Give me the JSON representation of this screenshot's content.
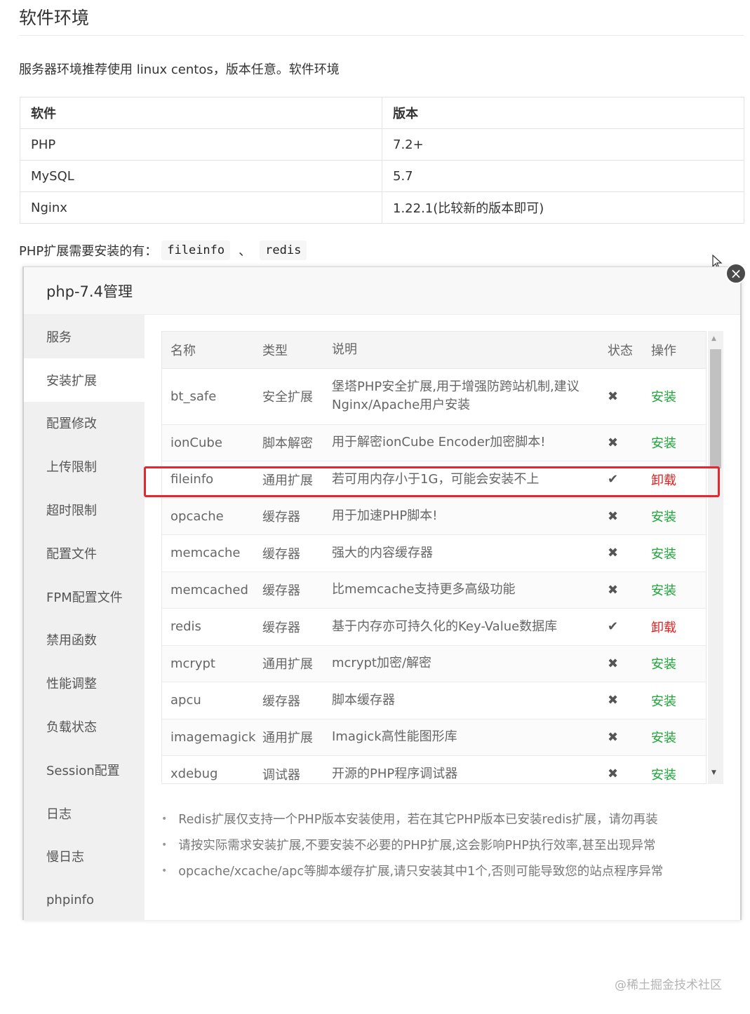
{
  "doc": {
    "heading": "软件环境",
    "paragraph": "服务器环境推荐使用 linux centos，版本任意。软件环境",
    "table": {
      "headers": [
        "软件",
        "版本"
      ],
      "rows": [
        [
          "PHP",
          "7.2+"
        ],
        [
          "MySQL",
          "5.7"
        ],
        [
          "Nginx",
          "1.22.1(比较新的版本即可)"
        ]
      ]
    },
    "ext_prefix": "PHP扩展需要安装的有：",
    "ext_1": "fileinfo",
    "ext_sep": "、",
    "ext_2": "redis"
  },
  "dialog": {
    "title": "php-7.4管理",
    "close_icon": "×",
    "sidebar": [
      "服务",
      "安装扩展",
      "配置修改",
      "上传限制",
      "超时限制",
      "配置文件",
      "FPM配置文件",
      "禁用函数",
      "性能调整",
      "负载状态",
      "Session配置",
      "日志",
      "慢日志",
      "phpinfo"
    ],
    "sidebar_active": "安装扩展",
    "columns": [
      "名称",
      "类型",
      "说明",
      "状态",
      "操作"
    ],
    "extensions": [
      {
        "name": "bt_safe",
        "type": "安全扩展",
        "desc": "堡塔PHP安全扩展,用于增强防跨站机制,建议Nginx/Apache用户安装",
        "state": "✖",
        "op": "安装"
      },
      {
        "name": "ionCube",
        "type": "脚本解密",
        "desc": "用于解密ionCube Encoder加密脚本!",
        "state": "✖",
        "op": "安装"
      },
      {
        "name": "fileinfo",
        "type": "通用扩展",
        "desc": "若可用内存小于1G，可能会安装不上",
        "state": "✔",
        "op": "卸载"
      },
      {
        "name": "opcache",
        "type": "缓存器",
        "desc": "用于加速PHP脚本!",
        "state": "✖",
        "op": "安装"
      },
      {
        "name": "memcache",
        "type": "缓存器",
        "desc": "强大的内容缓存器",
        "state": "✖",
        "op": "安装"
      },
      {
        "name": "memcached",
        "type": "缓存器",
        "desc": "比memcache支持更多高级功能",
        "state": "✖",
        "op": "安装"
      },
      {
        "name": "redis",
        "type": "缓存器",
        "desc": "基于内存亦可持久化的Key-Value数据库",
        "state": "✔",
        "op": "卸载"
      },
      {
        "name": "mcrypt",
        "type": "通用扩展",
        "desc": "mcrypt加密/解密",
        "state": "✖",
        "op": "安装"
      },
      {
        "name": "apcu",
        "type": "缓存器",
        "desc": "脚本缓存器",
        "state": "✖",
        "op": "安装"
      },
      {
        "name": "imagemagick",
        "type": "通用扩展",
        "desc": "Imagick高性能图形库",
        "state": "✖",
        "op": "安装"
      },
      {
        "name": "xdebug",
        "type": "调试器",
        "desc": "开源的PHP程序调试器",
        "state": "✖",
        "op": "安装"
      }
    ],
    "tips": [
      "Redis扩展仅支持一个PHP版本安装使用，若在其它PHP版本已安装redis扩展，请勿再装",
      "请按实际需求安装扩展,不要安装不必要的PHP扩展,这会影响PHP执行效率,甚至出现异常",
      "opcache/xcache/apc等脚本缓存扩展,请只安装其中1个,否则可能导致您的站点程序异常"
    ]
  },
  "colors": {
    "install": "#20a53a",
    "uninstall": "#e52222",
    "highlight": "#e8262e"
  },
  "watermark": "@稀土掘金技术社区"
}
